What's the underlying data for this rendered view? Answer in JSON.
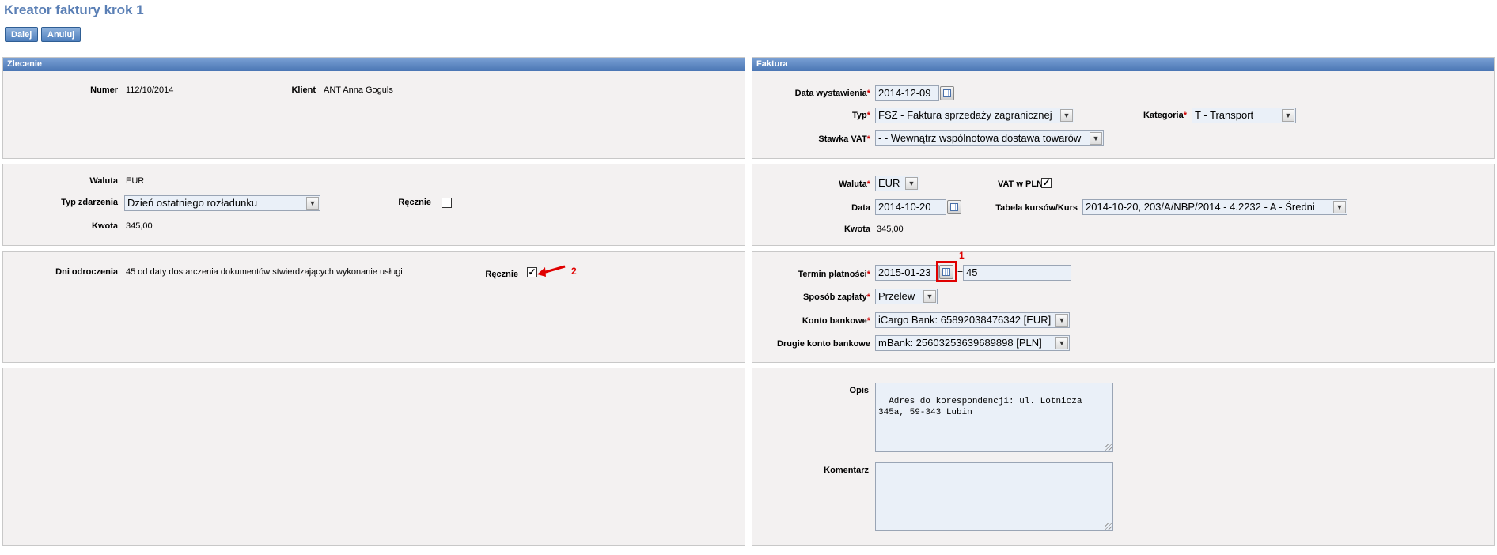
{
  "page": {
    "title": "Kreator faktury krok 1"
  },
  "toolbar": {
    "next_label": "Dalej",
    "cancel_label": "Anuluj"
  },
  "zlecenie": {
    "header": "Zlecenie",
    "numer_label": "Numer",
    "numer_value": "112/10/2014",
    "klient_label": "Klient",
    "klient_value": "ANT Anna Goguls",
    "waluta_label": "Waluta",
    "waluta_value": "EUR",
    "typ_zdarzenia_label": "Typ zdarzenia",
    "typ_zdarzenia_value": "Dzień ostatniego rozładunku",
    "recznie_label": "Ręcznie",
    "kwota_label": "Kwota",
    "kwota_value": "345,00",
    "dni_label": "Dni odroczenia",
    "dni_value": "45 od daty dostarczenia dokumentów stwierdzających wykonanie usługi",
    "recznie2_label": "Ręcznie"
  },
  "faktura": {
    "header": "Faktura",
    "data_wyst_label": "Data wystawienia",
    "data_wyst_value": "2014-12-09",
    "typ_label": "Typ",
    "typ_value": "FSZ - Faktura sprzedaży zagranicznej",
    "kategoria_label": "Kategoria",
    "kategoria_value": "T - Transport",
    "stawka_label": "Stawka VAT",
    "stawka_value": "- - Wewnątrz wspólnotowa dostawa towarów",
    "waluta_label": "Waluta",
    "waluta_value": "EUR",
    "vat_pln_label": "VAT w PLN",
    "data_label": "Data",
    "data_value": "2014-10-20",
    "tabela_label": "Tabela kursów/Kurs",
    "tabela_value": "2014-10-20, 203/A/NBP/2014 - 4.2232 - A - Średni",
    "kwota_label": "Kwota",
    "kwota_value": "345,00",
    "termin_label": "Termin płatności",
    "termin_value": "2015-01-23",
    "termin_sep": "=",
    "termin_days": "45",
    "sposob_label": "Sposób zapłaty",
    "sposob_value": "Przelew",
    "konto_label": "Konto bankowe",
    "konto_value": "iCargo Bank: 65892038476342 [EUR]",
    "konto2_label": "Drugie konto bankowe",
    "konto2_value": "mBank: 25603253639689898 [PLN]",
    "opis_label": "Opis",
    "opis_value": "Adres do korespondencji: ul. Lotnicza\n345a, 59-343 Lubin",
    "komentarz_label": "Komentarz",
    "komentarz_value": ""
  },
  "annotations": {
    "marker1": "1",
    "marker2": "2"
  },
  "common": {
    "req_mark": "*",
    "check_mark": "✓",
    "dropdown_arrow": "▼"
  },
  "colors": {
    "header_blue": "#5a7fb5",
    "panel_bg": "#f3f1f1",
    "annotation_red": "#e00000"
  }
}
